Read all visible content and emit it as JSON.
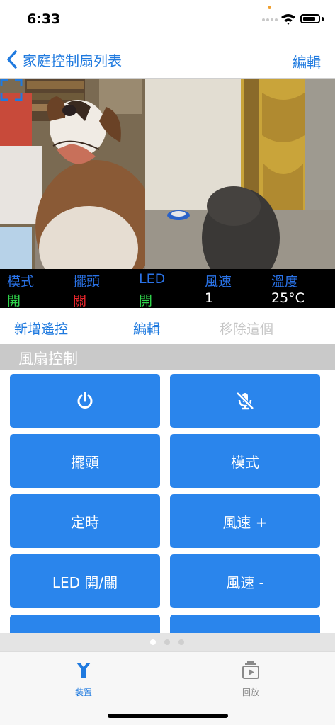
{
  "status_bar": {
    "time": "6:33"
  },
  "nav": {
    "back_title": "家庭控制扇列表",
    "edit": "編輯"
  },
  "camera": {
    "fullscreen_icon": "fullscreen-icon"
  },
  "status_strip": {
    "items": [
      {
        "label": "模式",
        "value": "開",
        "value_color": "#2fd24a"
      },
      {
        "label": "擺頭",
        "value": "關",
        "value_color": "#e8262c"
      },
      {
        "label": "LED",
        "value": "開",
        "value_color": "#2fd24a"
      },
      {
        "label": "風速",
        "value": "1",
        "value_color": "#ffffff"
      },
      {
        "label": "溫度",
        "value": "25°C",
        "value_color": "#ffffff"
      }
    ],
    "label_color": "#2a73e8"
  },
  "actions": {
    "add_remote": "新增遙控",
    "edit": "編輯",
    "remove": "移除這個"
  },
  "section": {
    "title": "風扇控制"
  },
  "controls": {
    "power_icon": "power-icon",
    "mute_icon": "mute-microphone-icon",
    "swing": "擺頭",
    "mode": "模式",
    "timer": "定時",
    "speed_up": "風速 +",
    "led_toggle": "LED 開/關",
    "speed_down": "風速 -"
  },
  "pagination": {
    "current": 1,
    "total": 3
  },
  "tabs": [
    {
      "label": "裝置",
      "icon": "device-icon",
      "active": true
    },
    {
      "label": "回放",
      "icon": "playback-icon",
      "active": false
    }
  ],
  "colors": {
    "accent": "#1f7adf",
    "button": "#2a85ec",
    "section": "#c9c9c9"
  }
}
